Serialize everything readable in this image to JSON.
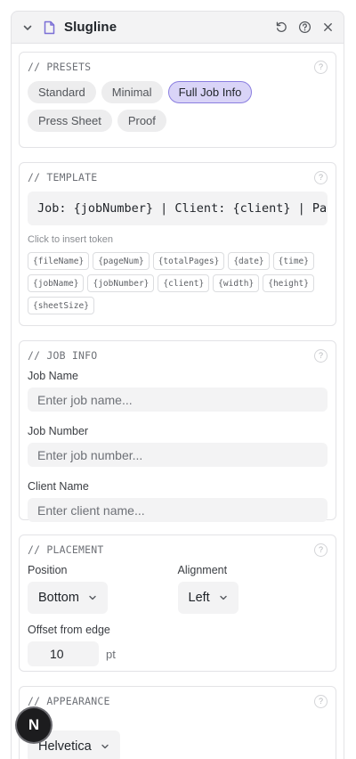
{
  "panel": {
    "title": "Slugline",
    "icons": [
      "chevron-down-icon",
      "document-icon",
      "reset-icon",
      "help-icon",
      "close-icon"
    ]
  },
  "presets": {
    "title": "// PRESETS",
    "items": [
      {
        "label": "Standard",
        "active": false
      },
      {
        "label": "Minimal",
        "active": false
      },
      {
        "label": "Full Job Info",
        "active": true
      },
      {
        "label": "Press Sheet",
        "active": false
      },
      {
        "label": "Proof",
        "active": false
      }
    ]
  },
  "template": {
    "title": "// TEMPLATE",
    "value": "Job: {jobNumber} | Client: {client} | Page {pageNum}/{totalPages}",
    "hint": "Click to insert token",
    "tokens": [
      "{fileName}",
      "{pageNum}",
      "{totalPages}",
      "{date}",
      "{time}",
      "{jobName}",
      "{jobNumber}",
      "{client}",
      "{width}",
      "{height}",
      "{sheetSize}"
    ]
  },
  "job_info": {
    "title": "// JOB INFO",
    "job_name_label": "Job Name",
    "job_name_placeholder": "Enter job name...",
    "job_number_label": "Job Number",
    "job_number_placeholder": "Enter job number...",
    "client_name_label": "Client Name",
    "client_name_placeholder": "Enter client name..."
  },
  "placement": {
    "title": "// PLACEMENT",
    "position_label": "Position",
    "position_value": "Bottom",
    "alignment_label": "Alignment",
    "alignment_value": "Left",
    "offset_label": "Offset from edge",
    "offset_value": "10",
    "offset_unit": "pt"
  },
  "appearance": {
    "title": "// APPEARANCE",
    "font_value": "Helvetica"
  },
  "fab": {
    "letter": "N"
  },
  "help_glyph": "?",
  "colors": {
    "accent": "#8b7fe0",
    "accent_bg": "#d9d4f7",
    "doc_icon": "#7b6fd6"
  }
}
